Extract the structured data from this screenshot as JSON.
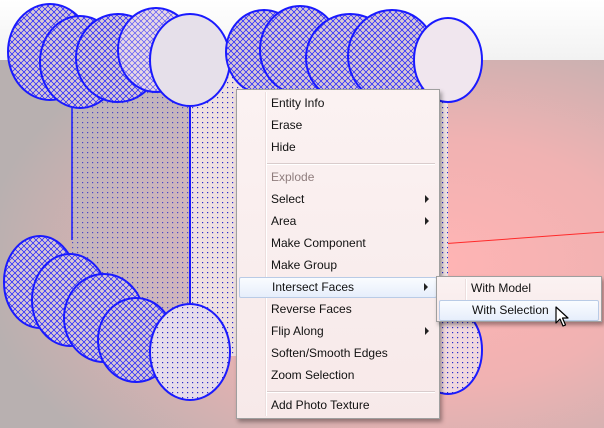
{
  "context_menu": {
    "items": [
      {
        "label": "Entity Info"
      },
      {
        "label": "Erase"
      },
      {
        "label": "Hide"
      },
      {
        "label": "Explode"
      },
      {
        "label": "Select"
      },
      {
        "label": "Area"
      },
      {
        "label": "Make Component"
      },
      {
        "label": "Make Group"
      },
      {
        "label": "Intersect Faces"
      },
      {
        "label": "Reverse Faces"
      },
      {
        "label": "Flip Along"
      },
      {
        "label": "Soften/Smooth Edges"
      },
      {
        "label": "Zoom Selection"
      },
      {
        "label": "Add Photo Texture"
      }
    ]
  },
  "submenu": {
    "items": [
      {
        "label": "With Model"
      },
      {
        "label": "With Selection"
      }
    ]
  },
  "colors": {
    "selection_blue": "#1a1aff",
    "menu_background": "#f9eeee",
    "highlight_border": "#b9cbe6",
    "axis_red": "#ff2a2a"
  }
}
